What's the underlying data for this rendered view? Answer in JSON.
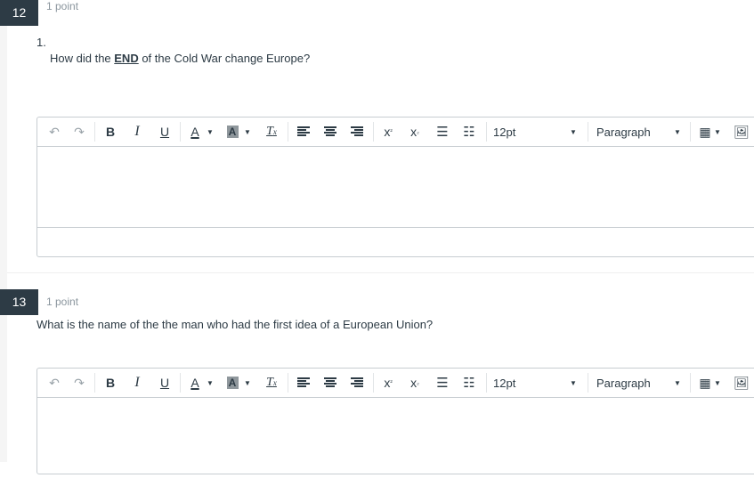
{
  "questions": [
    {
      "number": "12",
      "points": "1 point",
      "sub_number": "1.",
      "text_before": "How did the ",
      "text_emphasis": "END",
      "text_after": " of the Cold War change Europe?"
    },
    {
      "number": "13",
      "points": "1 point",
      "text": "What is the name of the the man who had the first idea of a European Union?"
    }
  ],
  "toolbar": {
    "font_size_value": "12pt",
    "block_format_value": "Paragraph",
    "icons": [
      "undo-icon",
      "redo-icon",
      "bold-icon",
      "italic-icon",
      "underline-icon",
      "text-color-icon",
      "highlight-color-icon",
      "clear-formatting-icon",
      "align-left-icon",
      "align-center-icon",
      "align-right-icon",
      "superscript-icon",
      "subscript-icon",
      "bullet-list-icon",
      "numbered-list-icon",
      "table-icon",
      "image-icon"
    ]
  },
  "colors": {
    "question_badge_bg": "#2d3b45",
    "text": "#2d3b45",
    "muted": "#8b969e",
    "border": "#c7cdd1"
  }
}
